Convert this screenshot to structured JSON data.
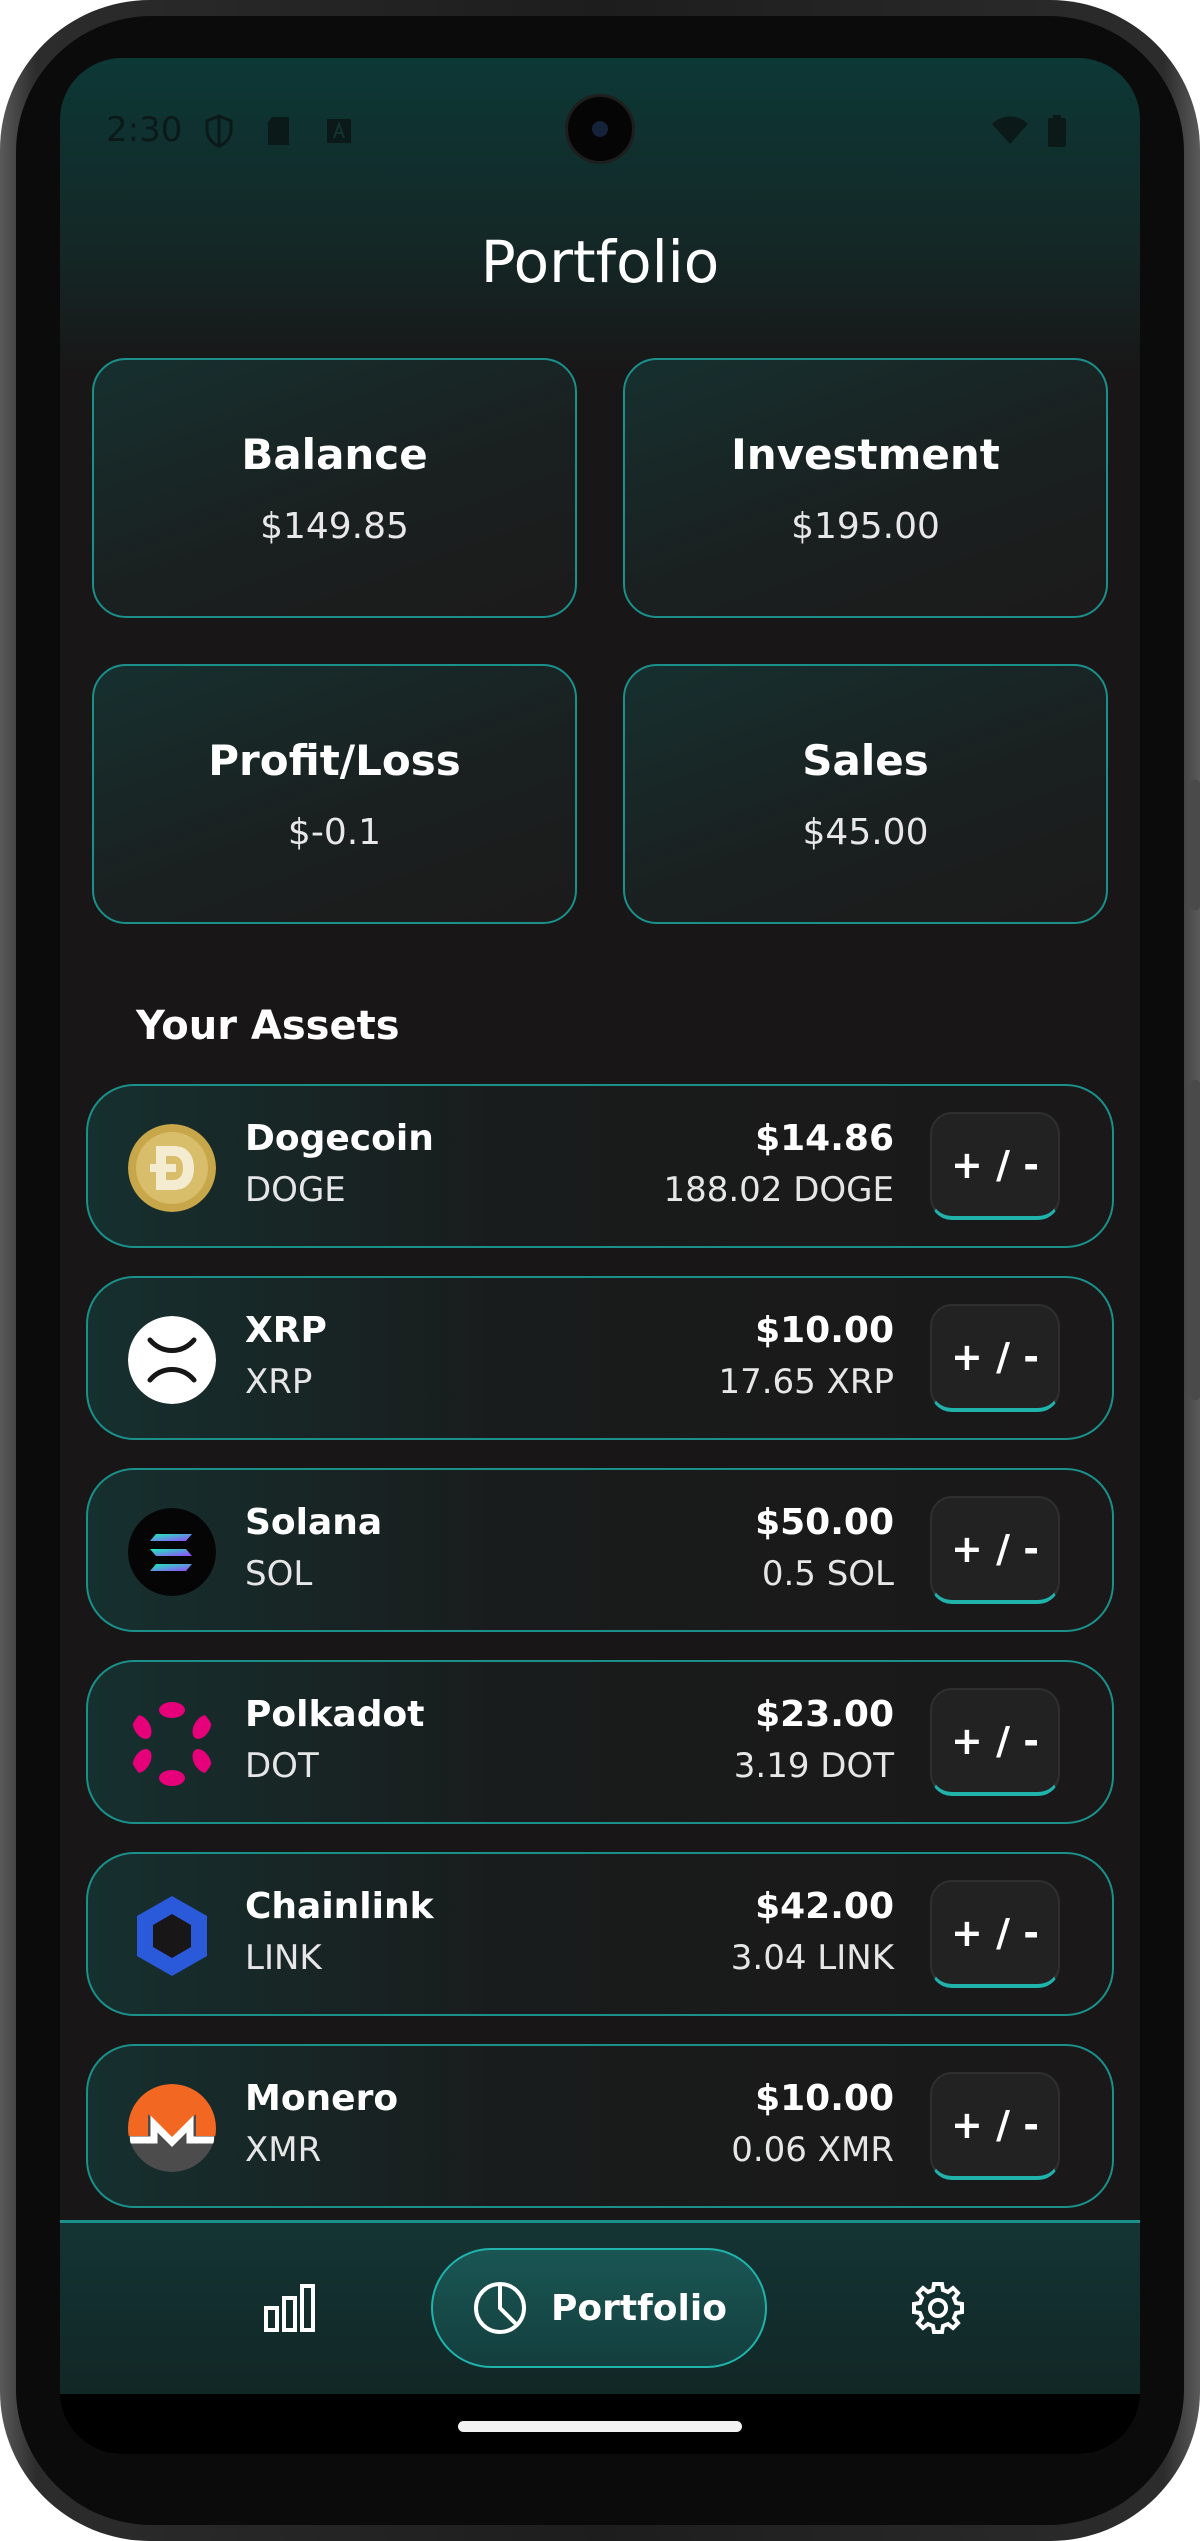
{
  "status_bar": {
    "time": "2:30"
  },
  "header": {
    "title": "Portfolio"
  },
  "stats": [
    {
      "label": "Balance",
      "value": "$149.85"
    },
    {
      "label": "Investment",
      "value": "$195.00"
    },
    {
      "label": "Profit/Loss",
      "value": "$-0.1"
    },
    {
      "label": "Sales",
      "value": "$45.00"
    }
  ],
  "assets_section": {
    "title": "Your Assets"
  },
  "assets": [
    {
      "name": "Dogecoin",
      "symbol": "DOGE",
      "value": "$14.86",
      "amount": "188.02 DOGE",
      "icon": "dogecoin-logo-icon",
      "button_label": "+ / -"
    },
    {
      "name": "XRP",
      "symbol": "XRP",
      "value": "$10.00",
      "amount": "17.65 XRP",
      "icon": "xrp-logo-icon",
      "button_label": "+ / -"
    },
    {
      "name": "Solana",
      "symbol": "SOL",
      "value": "$50.00",
      "amount": "0.5 SOL",
      "icon": "solana-logo-icon",
      "button_label": "+ / -"
    },
    {
      "name": "Polkadot",
      "symbol": "DOT",
      "value": "$23.00",
      "amount": "3.19 DOT",
      "icon": "polkadot-logo-icon",
      "button_label": "+ / -"
    },
    {
      "name": "Chainlink",
      "symbol": "LINK",
      "value": "$42.00",
      "amount": "3.04 LINK",
      "icon": "chainlink-logo-icon",
      "button_label": "+ / -"
    },
    {
      "name": "Monero",
      "symbol": "XMR",
      "value": "$10.00",
      "amount": "0.06 XMR",
      "icon": "monero-logo-icon",
      "button_label": "+ / -"
    }
  ],
  "bottom_nav": {
    "items": [
      {
        "icon": "bar-chart-icon",
        "label": ""
      },
      {
        "icon": "pie-chart-icon",
        "label": "Portfolio",
        "active": true
      },
      {
        "icon": "gear-icon",
        "label": ""
      }
    ]
  },
  "colors": {
    "accent": "#1fb3ab",
    "border": "#1b8f8a",
    "background": "#181616",
    "header_gradient": "#0c3836"
  }
}
